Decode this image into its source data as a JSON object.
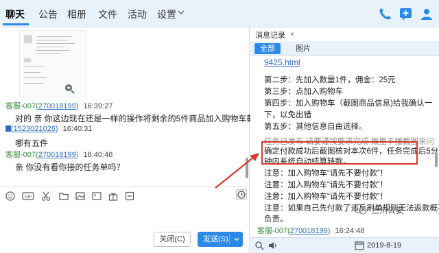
{
  "nav": {
    "tabs": [
      "聊天",
      "公告",
      "相册",
      "文件",
      "活动",
      "设置"
    ],
    "active_tab": "聊天",
    "accent_color": "#2a8ae6"
  },
  "chat": {
    "messages": [
      {
        "sender": "客服-007",
        "sender_id": "270018199",
        "time": "16:39:27",
        "text": "对的 亲 你这边现在还是一样的操作将剩余的5件商品加入购物车截图给我"
      },
      {
        "sender": "",
        "sender_id": "1523021026",
        "time": "16:40:31",
        "text": "哪有五件"
      },
      {
        "sender": "客服-007",
        "sender_id": "270018199",
        "time": "16:40:46",
        "text": "亲 你没有看你接的任务单吗？"
      }
    ],
    "toolbar_icons": [
      "emoji-icon",
      "gif-icon",
      "scissors-icon",
      "folder-icon",
      "picture-icon",
      "image-icon",
      "gift-icon",
      "more-icon",
      "history-clock-icon"
    ],
    "close_button": "关闭(C)",
    "send_button": "发送(S)"
  },
  "history": {
    "tab_label": "消息记录",
    "tab_close": "×",
    "filter_all": "全部",
    "filter_pictures": "图片",
    "lines": [
      {
        "text": "9425.html",
        "kind": "link"
      },
      {
        "text": "第二步：先加入数量1件，佣金：25元",
        "kind": "normal"
      },
      {
        "text": "第三步：点加入购物车",
        "kind": "normal"
      },
      {
        "text": "第四步：加入购物车（截图商品信息)给我确认一",
        "kind": "normal"
      },
      {
        "text": "下，以免出错",
        "kind": "normal"
      },
      {
        "text": "第五步：其他信息自由选择。",
        "kind": "normal"
      },
      {
        "text": "任务已发布 请要谨按要求完成 概里不懂截图来问",
        "kind": "faded"
      },
      {
        "text": "确定付款成功后截图核对本次6件，任务完成后5分",
        "kind": "normal"
      },
      {
        "text": "钟内系统自动结算转款。",
        "kind": "normal"
      },
      {
        "text": "注意：加入购物车“请先不要付款”！",
        "kind": "normal"
      },
      {
        "text": "注意：加入购物车“请先不要付款”！",
        "kind": "normal"
      },
      {
        "text": "注意：加入购物车“请先不要付款”！",
        "kind": "normal"
      },
      {
        "text": "注意：如果自己先付款了违反刷单规则无法返款概不",
        "kind": "normal"
      },
      {
        "text": "负责。",
        "kind": "normal"
      }
    ],
    "last_sender": "客服-007",
    "last_sender_id": "270018199",
    "last_time": "16:24:48",
    "date": "2019-8-19"
  },
  "watermark": "兰州公安",
  "highlight_color": "#d9382b"
}
